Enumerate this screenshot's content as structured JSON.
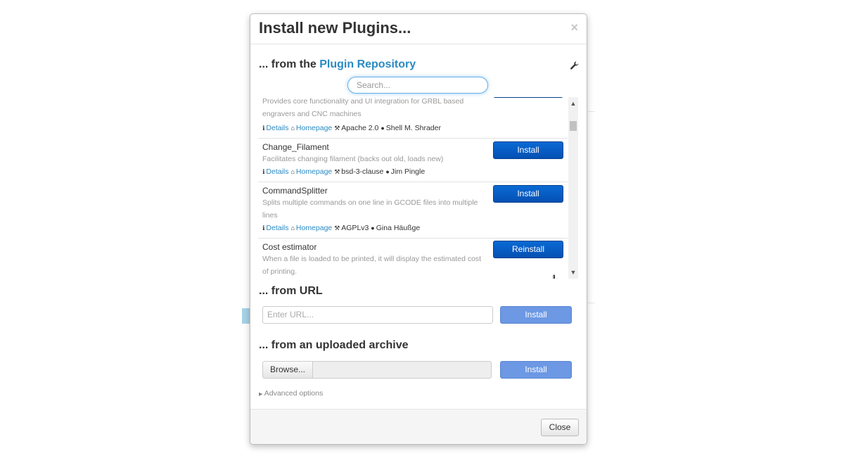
{
  "modal": {
    "title": "Install new Plugins...",
    "close_glyph": "×"
  },
  "repository": {
    "heading_prefix": "... from the ",
    "heading_link": "Plugin Repository",
    "search_placeholder": "Search...",
    "plugins": [
      {
        "name": "",
        "description": "Provides core functionality and UI integration for GRBL based engravers and CNC machines",
        "details": "Details",
        "homepage": "Homepage",
        "license": "Apache 2.0",
        "author": "Shell M. Shrader",
        "action": ""
      },
      {
        "name": "Change_Filament",
        "description": "Facilitates changing filament (backs out old, loads new)",
        "details": "Details",
        "homepage": "Homepage",
        "license": "bsd-3-clause",
        "author": "Jim Pingle",
        "action": "Install"
      },
      {
        "name": "CommandSplitter",
        "description": "Splits multiple commands on one line in GCODE files into multiple lines",
        "details": "Details",
        "homepage": "Homepage",
        "license": "AGPLv3",
        "author": "Gina Häußge",
        "action": "Install"
      },
      {
        "name": "Cost estimator",
        "description": "When a file is loaded to be printed, it will display the estimated cost of printing.",
        "action": "Reinstall"
      }
    ]
  },
  "url_section": {
    "heading": "... from URL",
    "placeholder": "Enter URL...",
    "button": "Install"
  },
  "archive_section": {
    "heading": "... from an uploaded archive",
    "browse": "Browse...",
    "button": "Install"
  },
  "advanced": "Advanced options",
  "footer": {
    "close": "Close"
  },
  "colors": {
    "primary": "#0a6ad4",
    "soft_primary": "#6c98e4",
    "link": "#2a8ac2"
  }
}
